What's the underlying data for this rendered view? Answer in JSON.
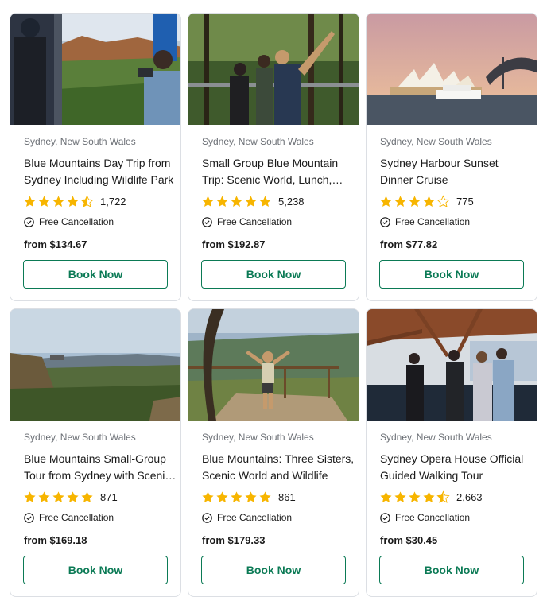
{
  "cards": [
    {
      "location": "Sydney, New South Wales",
      "title": "Blue Mountains Day Trip from Sydney Including Wildlife Park",
      "rating": 4.5,
      "review_count": "1,722",
      "cancellation": "Free Cancellation",
      "price": "from $134.67",
      "button": "Book Now",
      "image_alt": "Tourists looking at Blue Mountains valley from cable car"
    },
    {
      "location": "Sydney, New South Wales",
      "title": "Small Group Blue Mountain Trip: Scenic World, Lunch, Wildlife",
      "rating": 5,
      "review_count": "5,238",
      "cancellation": "Free Cancellation",
      "price": "from $192.87",
      "button": "Book Now",
      "image_alt": "Guide pointing to treetops on forest boardwalk"
    },
    {
      "location": "Sydney, New South Wales",
      "title": "Sydney Harbour Sunset Dinner Cruise",
      "rating": 4,
      "review_count": "775",
      "cancellation": "Free Cancellation",
      "price": "from $77.82",
      "button": "Book Now",
      "image_alt": "Cruise boat passing Sydney Opera House at sunset"
    },
    {
      "location": "Sydney, New South Wales",
      "title": "Blue Mountains Small-Group Tour from Sydney with Scenic World",
      "rating": 5,
      "review_count": "871",
      "cancellation": "Free Cancellation",
      "price": "from $169.18",
      "button": "Book Now",
      "image_alt": "Blue Mountains valley with skyway cable car"
    },
    {
      "location": "Sydney, New South Wales",
      "title": "Blue Mountains: Three Sisters, Scenic World and Wildlife",
      "rating": 5,
      "review_count": "861",
      "cancellation": "Free Cancellation",
      "price": "from $179.33",
      "button": "Book Now",
      "image_alt": "Tourist with raised arms at mountain lookout"
    },
    {
      "location": "Sydney, New South Wales",
      "title": "Sydney Opera House Official Guided Walking Tour",
      "rating": 4.5,
      "review_count": "2,663",
      "cancellation": "Free Cancellation",
      "price": "from $30.45",
      "button": "Book Now",
      "image_alt": "Guide speaking to group inside Opera House foyer"
    }
  ],
  "colors": {
    "accent": "#0b7a55",
    "star": "#f7b500",
    "star_empty": "#f7b500",
    "muted_text": "#6b6f75",
    "border": "#dcdfe4"
  },
  "icons": {
    "star": "star-icon",
    "cancellation": "check-circle-icon"
  }
}
